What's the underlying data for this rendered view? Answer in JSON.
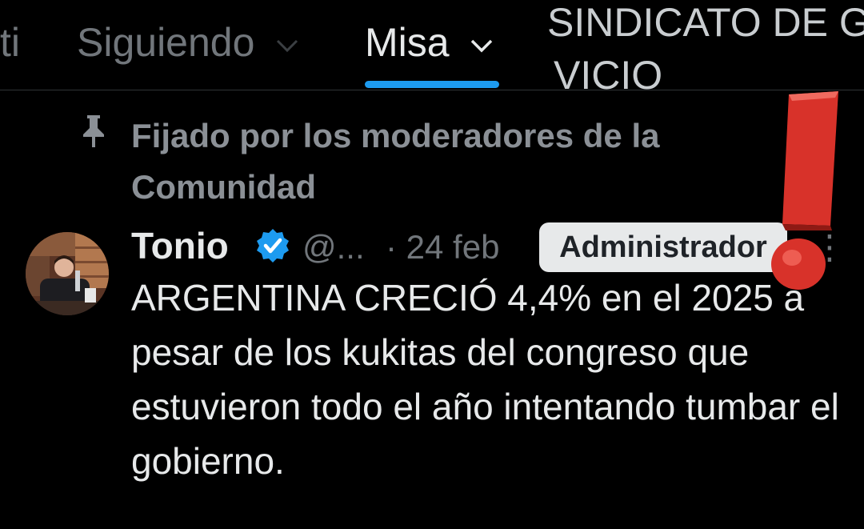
{
  "tabs": [
    {
      "label": "ti",
      "state": "dim"
    },
    {
      "label": "Siguiendo",
      "state": "dim"
    },
    {
      "label": "Misa",
      "state": "active"
    }
  ],
  "partial_tab": {
    "line1": "SINDICATO DE G",
    "line2": "VICIO"
  },
  "pinned": {
    "text": "Fijado por los moderadores de la Comunidad"
  },
  "post": {
    "name": "Tonio",
    "handle": "@...",
    "time": "· 24 feb",
    "badge": "Administrador",
    "text": "ARGENTINA CRECIÓ 4,4% en el 2025 a pesar de los kukitas del congreso que estuvieron todo el año intentando tumbar el gobierno."
  },
  "colors": {
    "accent": "#1d9bf0",
    "exclamation": "#d8322a"
  },
  "icons": {
    "pin": "pin-icon",
    "verified": "verified-badge-icon",
    "chevron": "chevron-down-icon"
  }
}
